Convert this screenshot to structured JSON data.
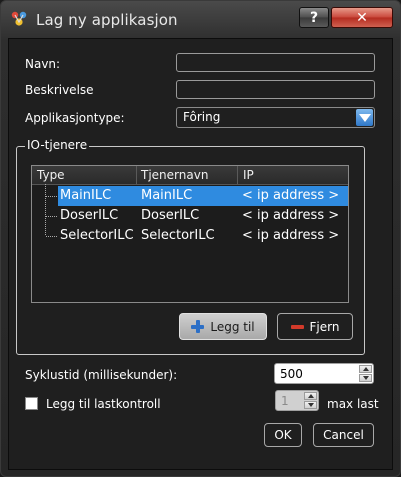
{
  "window": {
    "title": "Lag ny applikasjon",
    "help_glyph": "?",
    "close_glyph": "✕"
  },
  "form": {
    "name_label": "Navn:",
    "name_value": "",
    "description_label": "Beskrivelse",
    "description_value": "",
    "app_type_label": "Applikasjontype:",
    "app_type_value": "Fôring"
  },
  "io_group": {
    "title": "IO-tjenere",
    "columns": [
      "Type",
      "Tjenernavn",
      "IP"
    ],
    "rows": [
      {
        "type": "MainILC",
        "server": "MainILC",
        "ip": "< ip address >",
        "selected": true
      },
      {
        "type": "DoserILC",
        "server": "DoserILC",
        "ip": "< ip address >",
        "selected": false
      },
      {
        "type": "SelectorILC",
        "server": "SelectorILC",
        "ip": "< ip address >",
        "selected": false
      }
    ],
    "add_label": "Legg til",
    "remove_label": "Fjern"
  },
  "cycle": {
    "label": "Syklustid (millisekunder):",
    "value": "500"
  },
  "load_control": {
    "label": "Legg til lastkontroll",
    "checked": false,
    "value": "1",
    "max_label": "max last"
  },
  "footer": {
    "ok_label": "OK",
    "cancel_label": "Cancel"
  },
  "colors": {
    "selection": "#2f8be0",
    "background": "#1f1f1f",
    "close_button": "#c9463a"
  }
}
